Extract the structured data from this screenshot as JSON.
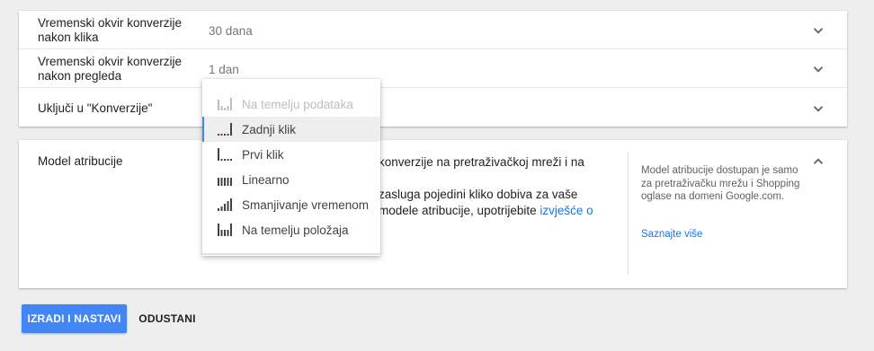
{
  "settings": {
    "rows": [
      {
        "label": "Vremenski okvir konverzije nakon klika",
        "value": "30 dana"
      },
      {
        "label": "Vremenski okvir konverzije nakon pregleda",
        "value": "1 dan"
      },
      {
        "label": "Uključi u \"Konverzije\"",
        "value": ""
      }
    ]
  },
  "attribution": {
    "label": "Model atribucije",
    "line1": "konverzije na pretraživačkoj mreži i na",
    "line2": "zasluga pojedini kliko dobiva za vaše",
    "line3_text": "modele atribucije, upotrijebite ",
    "line3_link": "izvješće o",
    "side_text": "Model atribucije dostupan je samo za pretraživačku mrežu i Shopping oglase na domeni Google.com.",
    "side_link": "Saznajte više"
  },
  "dropdown": {
    "selected_index": 1,
    "items": [
      {
        "label": "Na temelju podataka",
        "icon": "data-driven-icon",
        "disabled": true
      },
      {
        "label": "Zadnji klik",
        "icon": "last-click-icon",
        "disabled": false
      },
      {
        "label": "Prvi klik",
        "icon": "first-click-icon",
        "disabled": false
      },
      {
        "label": "Linearno",
        "icon": "linear-icon",
        "disabled": false
      },
      {
        "label": "Smanjivanje vremenom",
        "icon": "time-decay-icon",
        "disabled": false
      },
      {
        "label": "Na temelju položaja",
        "icon": "position-based-icon",
        "disabled": false
      }
    ]
  },
  "actions": {
    "primary": "IZRADI I NASTAVI",
    "cancel": "ODUSTANI"
  },
  "colors": {
    "accent": "#4285f4",
    "link": "#1a73e8",
    "background": "#eeeeee"
  }
}
